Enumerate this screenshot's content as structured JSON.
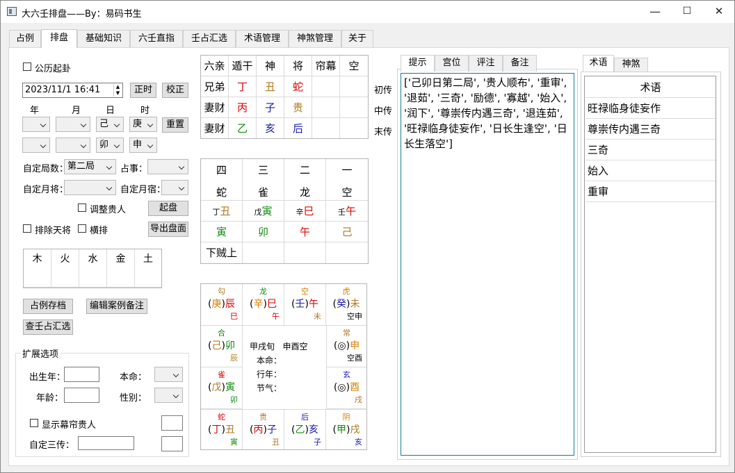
{
  "window": {
    "title": "大六壬排盘——By：易码书生",
    "min": "—",
    "max": "☐",
    "close": "✕"
  },
  "main_tabs": [
    "占例",
    "排盘",
    "基础知识",
    "六壬直指",
    "壬占汇选",
    "术语管理",
    "神煞管理",
    "关于"
  ],
  "left": {
    "gongli_label": "公历起卦",
    "datetime": "2023/11/1 16:41",
    "btn_zhengshi": "正时",
    "btn_jiaozheng": "校正",
    "col_labels": [
      "年",
      "月",
      "日",
      "时"
    ],
    "row1": {
      "day": "己",
      "hour": "庚"
    },
    "btn_reset": "重置",
    "row2": {
      "day": "卯",
      "hour": "申"
    },
    "zidingjushu_label": "自定局数：",
    "jushu": "第二局",
    "zhanshi_label": "占事：",
    "zidingyuejiang_label": "自定月将：",
    "zidingyuesu_label": "自定月宿：",
    "tiaozheng_label": "调整贵人",
    "btn_qipan": "起盘",
    "paichu_label": "排除天将",
    "hengpai_label": "横排",
    "btn_export": "导出盘面",
    "wuxing": [
      "木",
      "火",
      "水",
      "金",
      "土"
    ],
    "btn_save": "占例存档",
    "btn_edit": "编辑案例备注",
    "btn_query": "查壬占汇选",
    "ext": {
      "title": "扩展选项",
      "birth": "出生年：",
      "benming": "本命：",
      "age": "年龄：",
      "gender": "性别：",
      "show_label": "显示幕帘贵人",
      "sanchuan": "自定三传："
    }
  },
  "liuqin": {
    "headers": [
      "六亲",
      "遁干",
      "神",
      "将",
      "帘幕",
      "空"
    ],
    "rows": [
      {
        "a": "兄弟",
        "b": "丁",
        "c": "丑",
        "d": "蛇",
        "side": "初传"
      },
      {
        "a": "妻财",
        "b": "丙",
        "c": "子",
        "d": "贵",
        "side": "中传"
      },
      {
        "a": "妻财",
        "b": "乙",
        "c": "亥",
        "d": "后",
        "side": "末传"
      }
    ]
  },
  "sike": {
    "nums": [
      "四",
      "三",
      "二",
      "一"
    ],
    "jiang": [
      "蛇",
      "雀",
      "龙",
      "空"
    ],
    "upper": [
      {
        "g": "丁",
        "z": "丑"
      },
      {
        "g": "戊",
        "z": "寅"
      },
      {
        "g": "辛",
        "z": "巳"
      },
      {
        "g": "壬",
        "z": "午"
      }
    ],
    "lower": [
      "寅",
      "卯",
      "午",
      "己"
    ],
    "note": "下贼上"
  },
  "tianpan": {
    "top": [
      {
        "j": "勾",
        "g": "庚",
        "z": "辰",
        "b": "巳"
      },
      {
        "j": "龙",
        "g": "辛",
        "z": "巳",
        "b": "午"
      },
      {
        "j": "空",
        "g": "壬",
        "z": "午",
        "b": "未"
      },
      {
        "j": "虎",
        "g": "癸",
        "z": "未",
        "b": "空申"
      }
    ],
    "left": [
      {
        "j": "合",
        "g": "己",
        "z": "卯",
        "b": "辰"
      },
      {
        "j": "雀",
        "g": "戊",
        "z": "寅",
        "b": "卯"
      }
    ],
    "right": [
      {
        "j": "常",
        "g": "◎",
        "z": "申",
        "b": "空酉"
      },
      {
        "j": "玄",
        "g": "◎",
        "z": "酉",
        "b": "戌"
      }
    ],
    "bottom": [
      {
        "j": "蛇",
        "g": "丁",
        "z": "丑",
        "b": "寅"
      },
      {
        "j": "贵",
        "g": "丙",
        "z": "子",
        "b": "丑"
      },
      {
        "j": "后",
        "g": "乙",
        "z": "亥",
        "b": "子"
      },
      {
        "j": "阴",
        "g": "甲",
        "z": "戌",
        "b": "亥"
      }
    ],
    "center": {
      "xun": "甲戌旬",
      "kong": "申酉空",
      "benming": "本命：",
      "xingnian": "行年：",
      "jieqi": "节气："
    }
  },
  "tips": {
    "tabs": [
      "提示",
      "宫位",
      "评注",
      "备注"
    ],
    "content": "['己卯日第二局', '贵人顺布', '重审', '退茹', '三奇', '励德', '寡越', '始入', '润下', '尊崇传内遇三奇', '退连茹', '旺禄临身徒妄作', '日长生逢空', '日长生落空']"
  },
  "terms": {
    "tabs": [
      "术语",
      "神煞"
    ],
    "header": "术语",
    "items": [
      "旺禄临身徒妄作",
      "尊崇传内遇三奇",
      "三奇",
      "始入",
      "重审"
    ]
  }
}
